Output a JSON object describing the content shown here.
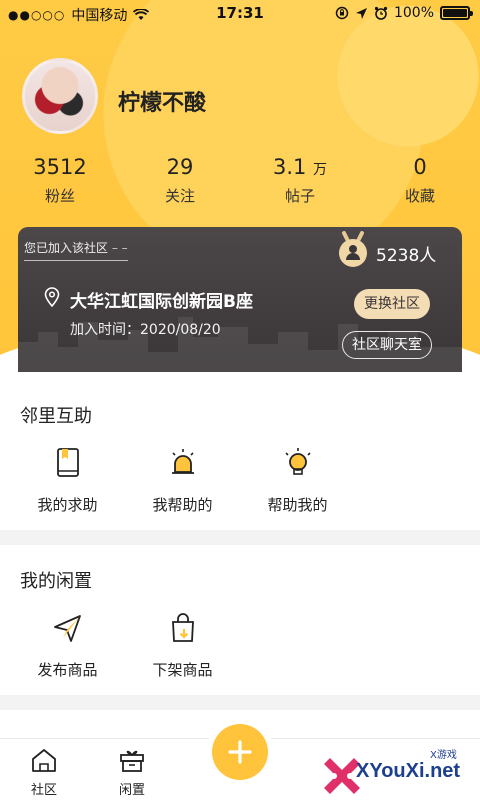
{
  "status_bar": {
    "carrier": "中国移动",
    "time": "17:31",
    "battery": "100%"
  },
  "profile": {
    "username": "柠檬不酸"
  },
  "stats": [
    {
      "value": "3512",
      "unit": "",
      "label": "粉丝"
    },
    {
      "value": "29",
      "unit": "",
      "label": "关注"
    },
    {
      "value": "3.1",
      "unit": "万",
      "label": "帖子"
    },
    {
      "value": "0",
      "unit": "",
      "label": "收藏"
    }
  ],
  "community": {
    "joined_tag": "您已加入该社区",
    "member_count": "5238人",
    "name": "大华江虹国际创新园B座",
    "join_time": "加入时间：2020/08/20",
    "change_button": "更换社区",
    "chat_button": "社区聊天室"
  },
  "neighbor_help": {
    "title": "邻里互助",
    "items": [
      {
        "label": "我的求助",
        "icon": "help-book-icon"
      },
      {
        "label": "我帮助的",
        "icon": "alarm-light-icon"
      },
      {
        "label": "帮助我的",
        "icon": "lightbulb-icon"
      }
    ]
  },
  "idle_goods": {
    "title": "我的闲置",
    "items": [
      {
        "label": "发布商品",
        "icon": "paper-plane-icon"
      },
      {
        "label": "下架商品",
        "icon": "shopping-bag-down-icon"
      }
    ]
  },
  "tabbar": {
    "items": [
      {
        "label": "社区",
        "icon": "house-icon"
      },
      {
        "label": "闲置",
        "icon": "gift-box-icon"
      }
    ],
    "center_icon": "plus-icon"
  },
  "watermark": {
    "text": "XYouXi.net",
    "small": "X游戏"
  },
  "colors": {
    "brand_yellow": "#ffc43b",
    "card_dark": "#3a3537"
  }
}
